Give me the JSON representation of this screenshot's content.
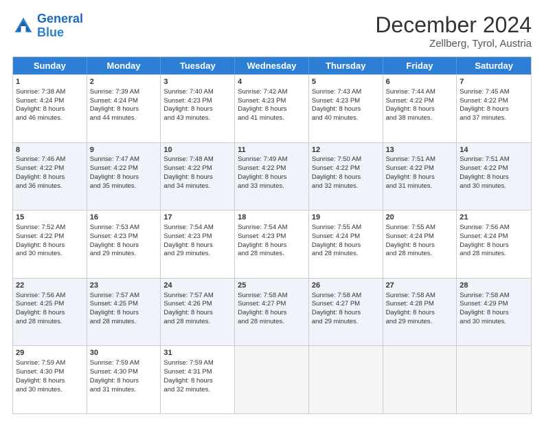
{
  "header": {
    "logo_line1": "General",
    "logo_line2": "Blue",
    "month_title": "December 2024",
    "subtitle": "Zellberg, Tyrol, Austria"
  },
  "days_of_week": [
    "Sunday",
    "Monday",
    "Tuesday",
    "Wednesday",
    "Thursday",
    "Friday",
    "Saturday"
  ],
  "weeks": [
    [
      {
        "day": "1",
        "lines": [
          "Sunrise: 7:38 AM",
          "Sunset: 4:24 PM",
          "Daylight: 8 hours",
          "and 46 minutes."
        ]
      },
      {
        "day": "2",
        "lines": [
          "Sunrise: 7:39 AM",
          "Sunset: 4:24 PM",
          "Daylight: 8 hours",
          "and 44 minutes."
        ]
      },
      {
        "day": "3",
        "lines": [
          "Sunrise: 7:40 AM",
          "Sunset: 4:23 PM",
          "Daylight: 8 hours",
          "and 43 minutes."
        ]
      },
      {
        "day": "4",
        "lines": [
          "Sunrise: 7:42 AM",
          "Sunset: 4:23 PM",
          "Daylight: 8 hours",
          "and 41 minutes."
        ]
      },
      {
        "day": "5",
        "lines": [
          "Sunrise: 7:43 AM",
          "Sunset: 4:23 PM",
          "Daylight: 8 hours",
          "and 40 minutes."
        ]
      },
      {
        "day": "6",
        "lines": [
          "Sunrise: 7:44 AM",
          "Sunset: 4:22 PM",
          "Daylight: 8 hours",
          "and 38 minutes."
        ]
      },
      {
        "day": "7",
        "lines": [
          "Sunrise: 7:45 AM",
          "Sunset: 4:22 PM",
          "Daylight: 8 hours",
          "and 37 minutes."
        ]
      }
    ],
    [
      {
        "day": "8",
        "lines": [
          "Sunrise: 7:46 AM",
          "Sunset: 4:22 PM",
          "Daylight: 8 hours",
          "and 36 minutes."
        ]
      },
      {
        "day": "9",
        "lines": [
          "Sunrise: 7:47 AM",
          "Sunset: 4:22 PM",
          "Daylight: 8 hours",
          "and 35 minutes."
        ]
      },
      {
        "day": "10",
        "lines": [
          "Sunrise: 7:48 AM",
          "Sunset: 4:22 PM",
          "Daylight: 8 hours",
          "and 34 minutes."
        ]
      },
      {
        "day": "11",
        "lines": [
          "Sunrise: 7:49 AM",
          "Sunset: 4:22 PM",
          "Daylight: 8 hours",
          "and 33 minutes."
        ]
      },
      {
        "day": "12",
        "lines": [
          "Sunrise: 7:50 AM",
          "Sunset: 4:22 PM",
          "Daylight: 8 hours",
          "and 32 minutes."
        ]
      },
      {
        "day": "13",
        "lines": [
          "Sunrise: 7:51 AM",
          "Sunset: 4:22 PM",
          "Daylight: 8 hours",
          "and 31 minutes."
        ]
      },
      {
        "day": "14",
        "lines": [
          "Sunrise: 7:51 AM",
          "Sunset: 4:22 PM",
          "Daylight: 8 hours",
          "and 30 minutes."
        ]
      }
    ],
    [
      {
        "day": "15",
        "lines": [
          "Sunrise: 7:52 AM",
          "Sunset: 4:22 PM",
          "Daylight: 8 hours",
          "and 30 minutes."
        ]
      },
      {
        "day": "16",
        "lines": [
          "Sunrise: 7:53 AM",
          "Sunset: 4:23 PM",
          "Daylight: 8 hours",
          "and 29 minutes."
        ]
      },
      {
        "day": "17",
        "lines": [
          "Sunrise: 7:54 AM",
          "Sunset: 4:23 PM",
          "Daylight: 8 hours",
          "and 29 minutes."
        ]
      },
      {
        "day": "18",
        "lines": [
          "Sunrise: 7:54 AM",
          "Sunset: 4:23 PM",
          "Daylight: 8 hours",
          "and 28 minutes."
        ]
      },
      {
        "day": "19",
        "lines": [
          "Sunrise: 7:55 AM",
          "Sunset: 4:24 PM",
          "Daylight: 8 hours",
          "and 28 minutes."
        ]
      },
      {
        "day": "20",
        "lines": [
          "Sunrise: 7:55 AM",
          "Sunset: 4:24 PM",
          "Daylight: 8 hours",
          "and 28 minutes."
        ]
      },
      {
        "day": "21",
        "lines": [
          "Sunrise: 7:56 AM",
          "Sunset: 4:24 PM",
          "Daylight: 8 hours",
          "and 28 minutes."
        ]
      }
    ],
    [
      {
        "day": "22",
        "lines": [
          "Sunrise: 7:56 AM",
          "Sunset: 4:25 PM",
          "Daylight: 8 hours",
          "and 28 minutes."
        ]
      },
      {
        "day": "23",
        "lines": [
          "Sunrise: 7:57 AM",
          "Sunset: 4:25 PM",
          "Daylight: 8 hours",
          "and 28 minutes."
        ]
      },
      {
        "day": "24",
        "lines": [
          "Sunrise: 7:57 AM",
          "Sunset: 4:26 PM",
          "Daylight: 8 hours",
          "and 28 minutes."
        ]
      },
      {
        "day": "25",
        "lines": [
          "Sunrise: 7:58 AM",
          "Sunset: 4:27 PM",
          "Daylight: 8 hours",
          "and 28 minutes."
        ]
      },
      {
        "day": "26",
        "lines": [
          "Sunrise: 7:58 AM",
          "Sunset: 4:27 PM",
          "Daylight: 8 hours",
          "and 29 minutes."
        ]
      },
      {
        "day": "27",
        "lines": [
          "Sunrise: 7:58 AM",
          "Sunset: 4:28 PM",
          "Daylight: 8 hours",
          "and 29 minutes."
        ]
      },
      {
        "day": "28",
        "lines": [
          "Sunrise: 7:58 AM",
          "Sunset: 4:29 PM",
          "Daylight: 8 hours",
          "and 30 minutes."
        ]
      }
    ],
    [
      {
        "day": "29",
        "lines": [
          "Sunrise: 7:59 AM",
          "Sunset: 4:30 PM",
          "Daylight: 8 hours",
          "and 30 minutes."
        ]
      },
      {
        "day": "30",
        "lines": [
          "Sunrise: 7:59 AM",
          "Sunset: 4:30 PM",
          "Daylight: 8 hours",
          "and 31 minutes."
        ]
      },
      {
        "day": "31",
        "lines": [
          "Sunrise: 7:59 AM",
          "Sunset: 4:31 PM",
          "Daylight: 8 hours",
          "and 32 minutes."
        ]
      },
      {
        "day": "",
        "lines": []
      },
      {
        "day": "",
        "lines": []
      },
      {
        "day": "",
        "lines": []
      },
      {
        "day": "",
        "lines": []
      }
    ]
  ]
}
